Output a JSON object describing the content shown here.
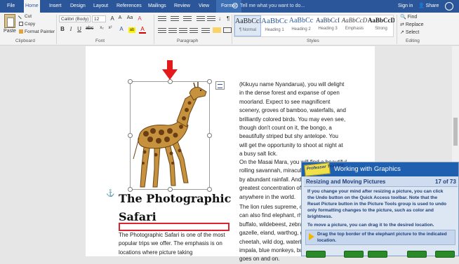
{
  "tabs": [
    "File",
    "Home",
    "Insert",
    "Design",
    "Layout",
    "References",
    "Mailings",
    "Review",
    "View",
    "Format"
  ],
  "tell_me": "Tell me what you want to do...",
  "account": {
    "sign_in": "Sign in",
    "share": "Share"
  },
  "clipboard": {
    "paste": "Paste",
    "cut": "Cut",
    "copy": "Copy",
    "format_painter": "Format Painter",
    "group": "Clipboard"
  },
  "font": {
    "name": "Calibri (Body)",
    "size": "12",
    "group": "Font"
  },
  "paragraph": {
    "group": "Paragraph"
  },
  "styles": {
    "group": "Styles",
    "items": [
      {
        "sample": "AaBbCcDd",
        "name": "¶ Normal"
      },
      {
        "sample": "AaBbCc",
        "name": "Heading 1"
      },
      {
        "sample": "AaBbCc",
        "name": "Heading 2"
      },
      {
        "sample": "AaBbCcI",
        "name": "Heading 3"
      },
      {
        "sample": "AaBbCcD",
        "name": "Emphasis"
      },
      {
        "sample": "AaBbCcD",
        "name": "Strong"
      }
    ]
  },
  "editing": {
    "find": "Find",
    "replace": "Replace",
    "select": "Select",
    "group": "Editing"
  },
  "document": {
    "heading_line1": "The Photographic",
    "heading_line2": "Safari",
    "left_para": [
      "The Photographic Safari is one of the most",
      "popular trips we offer. The emphasis is on",
      "locations where picture taking"
    ],
    "right_para1": [
      "(Kikuyu name Nyandarua), you will delight",
      "in the dense forest and expanse of open",
      "moorland. Expect to see magnificent",
      "scenery, groves of bamboo, waterfalls, and",
      "brilliantly colored birds. You may even see,",
      "though don't count on it, the bongo, a",
      "beautifully striped but shy antelope. You",
      "will get the opportunity to shoot at night at",
      "a busy salt lick."
    ],
    "right_para2": [
      "On the Masai Mara, you will find a beautiful",
      "rolling savannah, miraculously",
      "by abundant rainfall. And y",
      "greatest concentration of w",
      "anywhere in the world."
    ],
    "right_para3": [
      "The lion rules supreme, of",
      "can also find elephant, rhi",
      "buffalo, wildebeest, zebra,",
      "gazelle, eland, warthog, gi",
      "cheetah, wild dog, waterbu",
      "impala, blue monkeys, bus",
      "goes on and on."
    ]
  },
  "tutorial": {
    "logo": "Professor Teaches",
    "title": "Working with Graphics",
    "subtitle": "Resizing and Moving Pictures",
    "counter": "17 of 73",
    "lines": [
      "If you change your mind after resizing a picture, you can click",
      "the Undo button on the Quick Access toolbar. Note that the",
      "Reset Picture button in the Picture Tools group is used to undo",
      "only formatting changes to the picture, such as color and",
      "brightness."
    ],
    "move_line": "To move a picture, you can drag it to the desired location.",
    "instruction": [
      "Drag the top border of the elephant picture to the indicated",
      "location."
    ]
  }
}
